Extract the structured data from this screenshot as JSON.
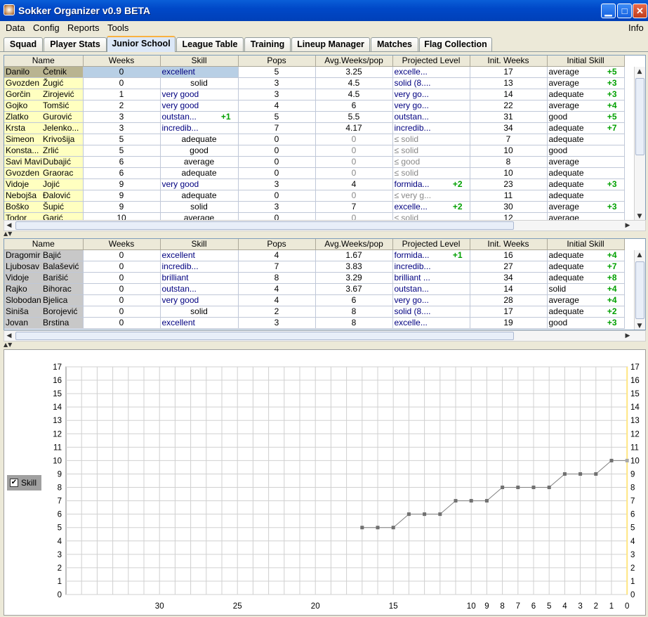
{
  "window": {
    "title": "Sokker Organizer v0.9 BETA"
  },
  "menu": {
    "data": "Data",
    "config": "Config",
    "reports": "Reports",
    "tools": "Tools",
    "info": "Info"
  },
  "tabs": [
    "Squad",
    "Player Stats",
    "Junior School",
    "League Table",
    "Training",
    "Lineup Manager",
    "Matches",
    "Flag Collection"
  ],
  "selected_tab": "Junior School",
  "columns": [
    "Name",
    "Weeks",
    "Skill",
    "Pops",
    "Avg.Weeks/pop",
    "Projected Level",
    "Init. Weeks",
    "Initial Skill"
  ],
  "current_juniors": [
    {
      "first": "Danilo",
      "last": "Četnik",
      "weeks": "0",
      "skill": "excellent",
      "skill_up": "",
      "pops": "5",
      "avg": "3.25",
      "proj": "excelle...",
      "proj_up": "",
      "init_weeks": "17",
      "init_skill": "average",
      "init_up": "+5"
    },
    {
      "first": "Gvozden",
      "last": "Žugić",
      "weeks": "0",
      "skill": "solid",
      "skill_up": "",
      "pops": "3",
      "avg": "4.5",
      "proj": "solid (8....",
      "proj_up": "",
      "init_weeks": "13",
      "init_skill": "average",
      "init_up": "+3"
    },
    {
      "first": "Gorčin",
      "last": "Zirojević",
      "weeks": "1",
      "skill": "very good",
      "skill_up": "",
      "pops": "3",
      "avg": "4.5",
      "proj": "very go...",
      "proj_up": "",
      "init_weeks": "14",
      "init_skill": "adequate",
      "init_up": "+3"
    },
    {
      "first": "Gojko",
      "last": "Tomšić",
      "weeks": "2",
      "skill": "very good",
      "skill_up": "",
      "pops": "4",
      "avg": "6",
      "proj": "very go...",
      "proj_up": "",
      "init_weeks": "22",
      "init_skill": "average",
      "init_up": "+4"
    },
    {
      "first": "Zlatko",
      "last": "Gurović",
      "weeks": "3",
      "skill": "outstan...",
      "skill_up": "+1",
      "pops": "5",
      "avg": "5.5",
      "proj": "outstan...",
      "proj_up": "",
      "init_weeks": "31",
      "init_skill": "good",
      "init_up": "+5"
    },
    {
      "first": "Krsta",
      "last": "Jelenko...",
      "weeks": "3",
      "skill": "incredib...",
      "skill_up": "",
      "pops": "7",
      "avg": "4.17",
      "proj": "incredib...",
      "proj_up": "",
      "init_weeks": "34",
      "init_skill": "adequate",
      "init_up": "+7"
    },
    {
      "first": "Simeon",
      "last": "Krivošija",
      "weeks": "5",
      "skill": "adequate",
      "skill_up": "",
      "pops": "0",
      "avg": "0",
      "proj": "≤ solid",
      "proj_up": "",
      "init_weeks": "7",
      "init_skill": "adequate",
      "init_up": ""
    },
    {
      "first": "Konsta...",
      "last": "Zrlić",
      "weeks": "5",
      "skill": "good",
      "skill_up": "",
      "pops": "0",
      "avg": "0",
      "proj": "≤ solid",
      "proj_up": "",
      "init_weeks": "10",
      "init_skill": "good",
      "init_up": ""
    },
    {
      "first": "Savi Mavi",
      "last": "Dubajić",
      "weeks": "6",
      "skill": "average",
      "skill_up": "",
      "pops": "0",
      "avg": "0",
      "proj": "≤ good",
      "proj_up": "",
      "init_weeks": "8",
      "init_skill": "average",
      "init_up": ""
    },
    {
      "first": "Gvozden",
      "last": "Graorac",
      "weeks": "6",
      "skill": "adequate",
      "skill_up": "",
      "pops": "0",
      "avg": "0",
      "proj": "≤ solid",
      "proj_up": "",
      "init_weeks": "10",
      "init_skill": "adequate",
      "init_up": ""
    },
    {
      "first": "Vidoje",
      "last": "Jojić",
      "weeks": "9",
      "skill": "very good",
      "skill_up": "",
      "pops": "3",
      "avg": "4",
      "proj": "formida...",
      "proj_up": "+2",
      "init_weeks": "23",
      "init_skill": "adequate",
      "init_up": "+3"
    },
    {
      "first": "Nebojša",
      "last": "Đalović",
      "weeks": "9",
      "skill": "adequate",
      "skill_up": "",
      "pops": "0",
      "avg": "0",
      "proj": "≤ very g...",
      "proj_up": "",
      "init_weeks": "11",
      "init_skill": "adequate",
      "init_up": ""
    },
    {
      "first": "Boško",
      "last": "Šupić",
      "weeks": "9",
      "skill": "solid",
      "skill_up": "",
      "pops": "3",
      "avg": "7",
      "proj": "excelle...",
      "proj_up": "+2",
      "init_weeks": "30",
      "init_skill": "average",
      "init_up": "+3"
    },
    {
      "first": "Todor",
      "last": "Garić",
      "weeks": "10",
      "skill": "average",
      "skill_up": "",
      "pops": "0",
      "avg": "0",
      "proj": "≤ solid",
      "proj_up": "",
      "init_weeks": "12",
      "init_skill": "average",
      "init_up": ""
    }
  ],
  "former_juniors": [
    {
      "first": "Dragomir",
      "last": "Bajić",
      "weeks": "0",
      "skill": "excellent",
      "pops": "4",
      "avg": "1.67",
      "proj": "formida...",
      "proj_up": "+1",
      "init_weeks": "16",
      "init_skill": "adequate",
      "init_up": "+4"
    },
    {
      "first": "Ljubosav",
      "last": "Balašević",
      "weeks": "0",
      "skill": "incredib...",
      "pops": "7",
      "avg": "3.83",
      "proj": "incredib...",
      "proj_up": "",
      "init_weeks": "27",
      "init_skill": "adequate",
      "init_up": "+7"
    },
    {
      "first": "Vidoje",
      "last": "Barišić",
      "weeks": "0",
      "skill": "brilliant",
      "pops": "8",
      "avg": "3.29",
      "proj": "brilliant ...",
      "proj_up": "",
      "init_weeks": "34",
      "init_skill": "adequate",
      "init_up": "+8"
    },
    {
      "first": "Rajko",
      "last": "Bihorac",
      "weeks": "0",
      "skill": "outstan...",
      "pops": "4",
      "avg": "3.67",
      "proj": "outstan...",
      "proj_up": "",
      "init_weeks": "14",
      "init_skill": "solid",
      "init_up": "+4"
    },
    {
      "first": "Slobodan",
      "last": "Bjelica",
      "weeks": "0",
      "skill": "very good",
      "pops": "4",
      "avg": "6",
      "proj": "very go...",
      "proj_up": "",
      "init_weeks": "28",
      "init_skill": "average",
      "init_up": "+4"
    },
    {
      "first": "Siniša",
      "last": "Borojević",
      "weeks": "0",
      "skill": "solid",
      "pops": "2",
      "avg": "8",
      "proj": "solid (8....",
      "proj_up": "",
      "init_weeks": "17",
      "init_skill": "adequate",
      "init_up": "+2"
    },
    {
      "first": "Jovan",
      "last": "Brstina",
      "weeks": "0",
      "skill": "excellent",
      "pops": "3",
      "avg": "8",
      "proj": "excelle...",
      "proj_up": "",
      "init_weeks": "19",
      "init_skill": "good",
      "init_up": "+3"
    }
  ],
  "legend": {
    "label": "Skill",
    "checked": "✔"
  },
  "chart_data": {
    "type": "line",
    "series": [
      {
        "name": "Skill",
        "points": [
          [
            13,
            5
          ],
          [
            14,
            5
          ],
          [
            15,
            5
          ],
          [
            16,
            6
          ],
          [
            17,
            6
          ],
          [
            18,
            6
          ],
          [
            19,
            7
          ],
          [
            20,
            7
          ],
          [
            21,
            7
          ],
          [
            22,
            8
          ],
          [
            23,
            8
          ],
          [
            24,
            8
          ],
          [
            25,
            8
          ],
          [
            26,
            9
          ],
          [
            27,
            9
          ],
          [
            28,
            9
          ],
          [
            29,
            10
          ],
          [
            30,
            10
          ]
        ]
      }
    ],
    "x_tick_labels": [
      "30",
      "25",
      "20",
      "15",
      "10",
      "9",
      "8",
      "7",
      "6",
      "5",
      "4",
      "3",
      "2",
      "1",
      "0"
    ],
    "y_ticks": [
      "0",
      "1",
      "2",
      "3",
      "4",
      "5",
      "6",
      "7",
      "8",
      "9",
      "10",
      "11",
      "12",
      "13",
      "14",
      "15",
      "16",
      "17"
    ],
    "ylim": [
      0,
      17
    ],
    "grid": true,
    "line_color": "#808080",
    "highlight_color": "#ffe680"
  }
}
